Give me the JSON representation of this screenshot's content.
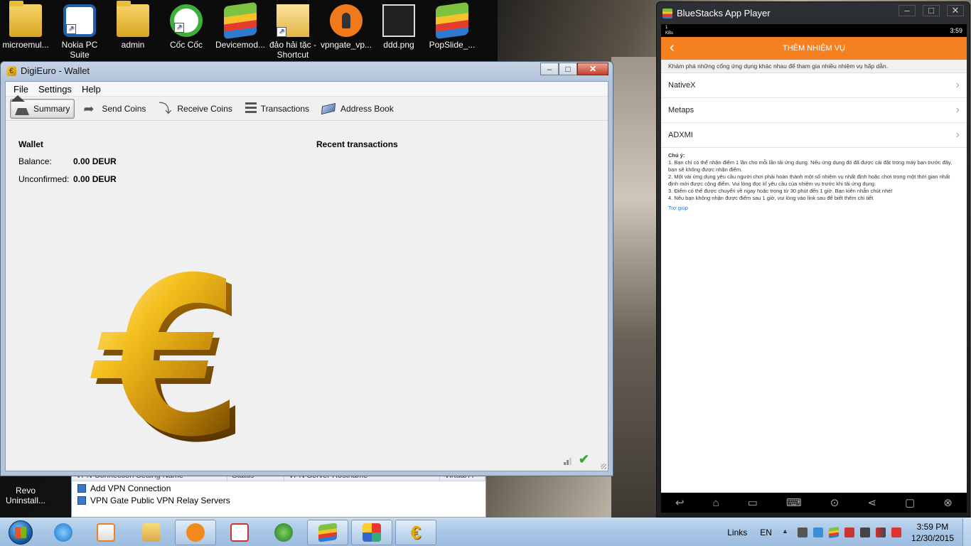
{
  "desktop": {
    "icons": [
      {
        "label": "microemul...",
        "icon": "folder-icon"
      },
      {
        "label": "Nokia PC Suite",
        "icon": "nokia-pc-suite-icon"
      },
      {
        "label": "admin",
        "icon": "user-folder-icon"
      },
      {
        "label": "Cốc Cốc",
        "icon": "coccoc-browser-icon"
      },
      {
        "label": "Devicemod...",
        "icon": "bluestacks-icon"
      },
      {
        "label": "đảo hải tặc - Shortcut",
        "icon": "folder-shortcut-icon"
      },
      {
        "label": "vpngate_vp...",
        "icon": "openvpn-icon"
      },
      {
        "label": "ddd.png",
        "icon": "image-file-icon"
      },
      {
        "label": "PopSlide_...",
        "icon": "bluestacks-icon"
      }
    ],
    "revo_label": "Revo Uninstall..."
  },
  "wallet_window": {
    "title": "DigiEuro - Wallet",
    "menu": [
      "File",
      "Settings",
      "Help"
    ],
    "toolbar": {
      "summary": "Summary",
      "send": "Send Coins",
      "receive": "Receive Coins",
      "transactions": "Transactions",
      "address_book": "Address Book"
    },
    "wallet_heading": "Wallet",
    "balance_label": "Balance:",
    "balance_value": "0.00 DEUR",
    "unconfirmed_label": "Unconfirmed:",
    "unconfirmed_value": "0.00 DEUR",
    "recent_heading": "Recent transactions",
    "euro_symbol": "€"
  },
  "vpn_window": {
    "columns": [
      "VPN Connection Setting Name",
      "Status",
      "VPN Server Hostname",
      "Virtual A"
    ],
    "rows": [
      "Add VPN Connection",
      "VPN Gate Public VPN Relay Servers"
    ]
  },
  "bluestacks": {
    "title": "BlueStacks App Player",
    "status_time": "3:59",
    "status_left": "1\nKBs",
    "header": "THÊM NHIỆM VỤ",
    "subtitle": "Khám phá những cổng ứng dụng khác nhau để tham gia nhiều nhiệm vụ hấp dẫn.",
    "items": [
      "NativeX",
      "Metaps",
      "ADXMI"
    ],
    "notes_title": "Chú ý:",
    "notes": [
      "1. Bạn chỉ có thể nhận điểm 1 lần cho mỗi lần tải ứng dụng. Nếu ứng dụng đó đã được cài đặt trong máy bạn trước đây, bạn sẽ không được nhận điểm.",
      "2. Một vài ứng dụng yêu cầu người chơi phải hoàn thành một số nhiệm vụ nhất định hoặc chơi trong một thời gian nhất định mới được cộng điểm. Vui lòng đọc kĩ yêu cầu của nhiệm vụ trước khi tải ứng dụng.",
      "3. Điểm có thể được chuyển về ngay hoặc trong từ 30 phút đến 1 giờ. Bạn kiên nhẫn chút nhé!",
      "4. Nếu bạn không nhận được điểm sau 1 giờ, vui lòng vào link sau để biết thêm chi tiết"
    ],
    "help_link": "Trợ giúp"
  },
  "taskbar": {
    "links_label": "Links",
    "lang": "EN",
    "time": "3:59 PM",
    "date": "12/30/2015"
  }
}
